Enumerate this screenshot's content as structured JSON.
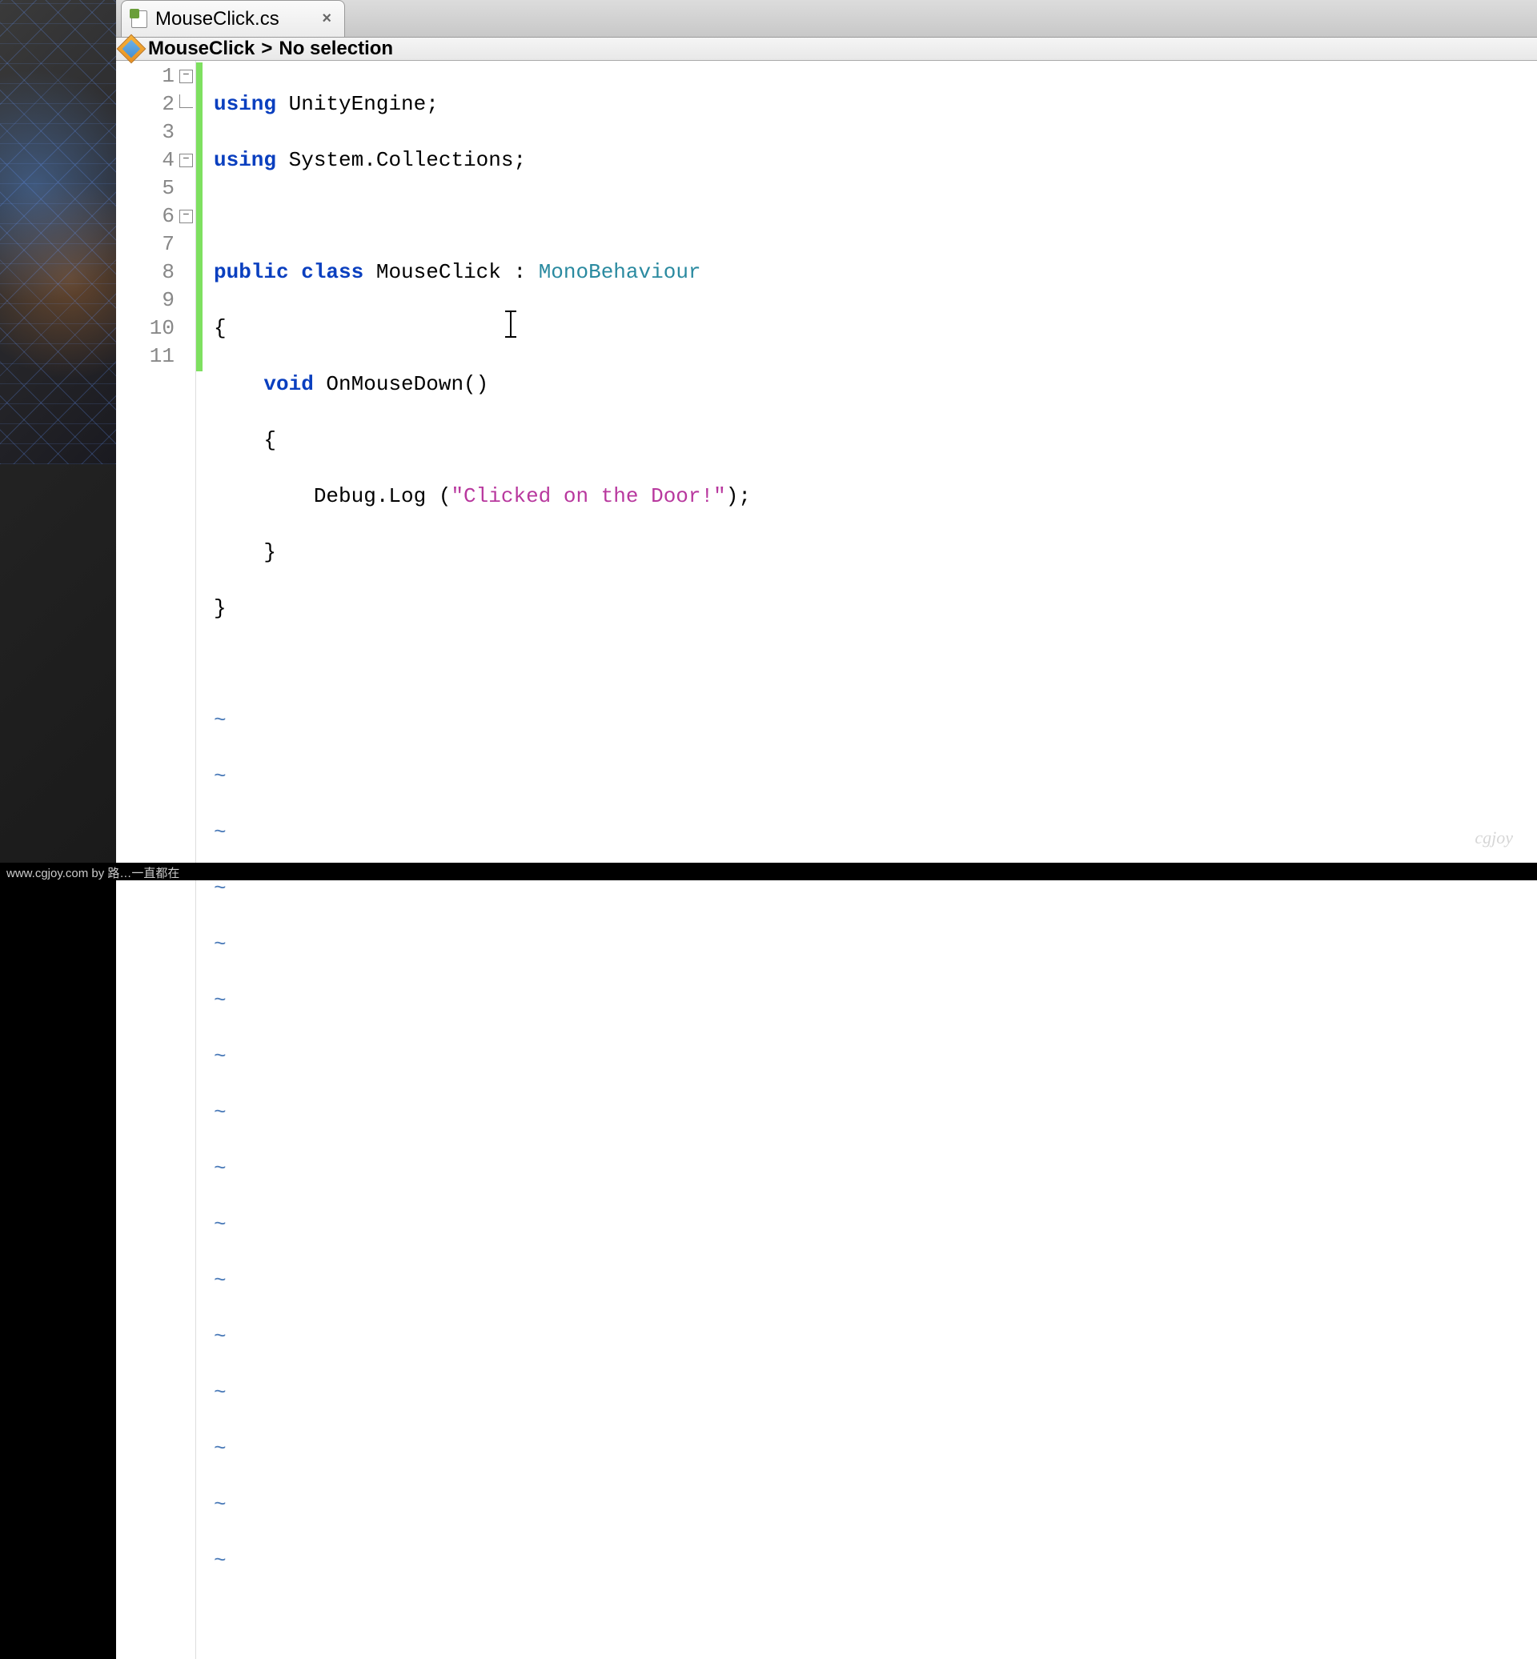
{
  "tab": {
    "filename": "MouseClick.cs",
    "close_symbol": "×"
  },
  "breadcrumb": {
    "class_name": "MouseClick",
    "separator": ">",
    "selection": "No selection"
  },
  "code": {
    "line1_using": "using",
    "line1_ns": " UnityEngine;",
    "line2_using": "using",
    "line2_ns": " System.Collections;",
    "line4_public": "public",
    "line4_class": " class",
    "line4_name": " MouseClick : ",
    "line4_base": "MonoBehaviour",
    "line5": "{",
    "line6_void": "    void",
    "line6_method": " OnMouseDown()",
    "line7": "    {",
    "line8_pre": "        Debug.Log (",
    "line8_str": "\"Clicked on the Door!\"",
    "line8_post": ");",
    "line9": "    }",
    "line10": "}",
    "tilde": "~"
  },
  "line_numbers": [
    "1",
    "2",
    "3",
    "4",
    "5",
    "6",
    "7",
    "8",
    "9",
    "10",
    "11"
  ],
  "fold_minus": "−",
  "watermark": "cgjoy",
  "footer": "www.cgjoy.com by 路…一直都在"
}
